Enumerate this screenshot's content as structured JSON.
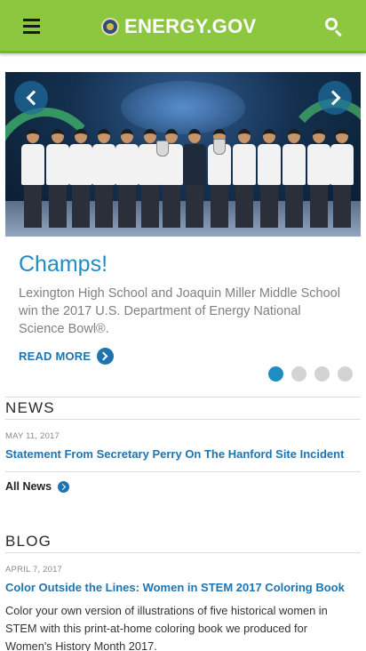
{
  "header": {
    "site_name": "ENERGY.GOV",
    "menu_icon": "hamburger-menu-icon",
    "search_icon": "search-icon",
    "background_color": "#8dc63f"
  },
  "hero": {
    "image_description": "students-with-trophies-on-stage",
    "prev_icon": "chevron-left-icon",
    "next_icon": "chevron-right-icon"
  },
  "feature": {
    "title": "Champs!",
    "description": "Lexington High School and Joaquin Miller Middle School win the 2017 U.S. Department of Energy National Science Bowl®.",
    "read_more_label": "READ MORE",
    "slide_count": 4,
    "active_slide": 1,
    "accent_color": "#1f8dc4"
  },
  "news": {
    "heading": "NEWS",
    "items": [
      {
        "date": "MAY 11, 2017",
        "title": "Statement From Secretary Perry On The Hanford Site Incident"
      }
    ],
    "all_label": "All News"
  },
  "blog": {
    "heading": "BLOG",
    "items": [
      {
        "date": "APRIL 7, 2017",
        "title": "Color Outside the Lines: Women in STEM 2017 Coloring Book",
        "description": "Color your own version of illustrations of five historical women in STEM with this print-at-home coloring book we produced for Women's History Month 2017."
      }
    ]
  }
}
